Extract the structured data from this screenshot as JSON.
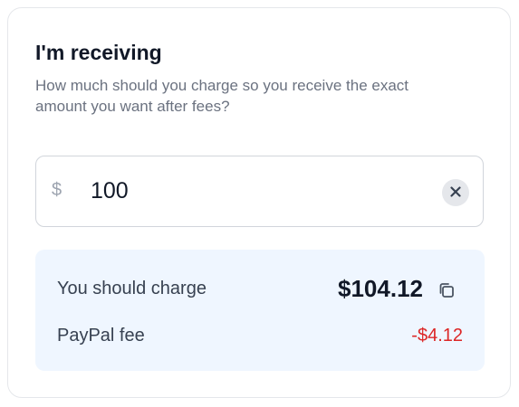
{
  "card": {
    "title": "I'm receiving",
    "subtitle": "How much should you charge so you receive the exact amount you want after fees?"
  },
  "input": {
    "currency_symbol": "$",
    "value": "100",
    "clear_icon": "close-icon"
  },
  "result": {
    "charge_label": "You should charge",
    "charge_value": "$104.12",
    "copy_icon": "copy-icon",
    "fee_label": "PayPal fee",
    "fee_value": "-$4.12"
  },
  "colors": {
    "result_background": "#eff6ff",
    "fee_color": "#dc2626",
    "text_primary": "#111827",
    "text_secondary": "#6b7280"
  }
}
